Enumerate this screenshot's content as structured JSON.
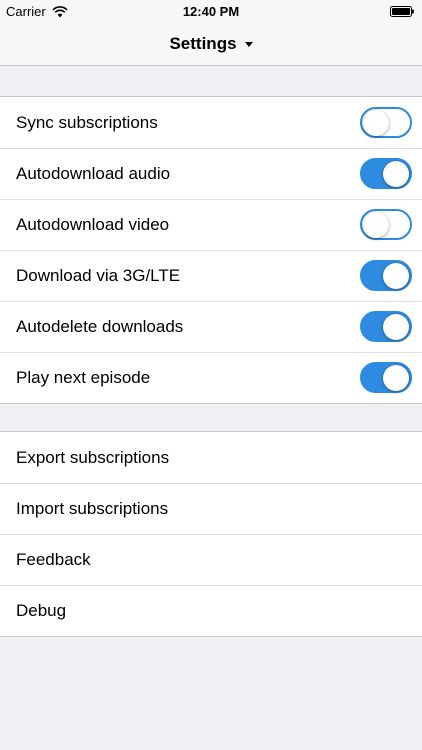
{
  "status_bar": {
    "carrier": "Carrier",
    "time": "12:40 PM",
    "wifi_icon": "wifi-icon",
    "battery_icon": "battery-icon"
  },
  "nav": {
    "title": "Settings",
    "dropdown_icon": "caret-down-icon"
  },
  "colors": {
    "accent": "#2d8be0",
    "background": "#efeff4",
    "bar": "#f7f7f7"
  },
  "toggles": [
    {
      "label": "Sync subscriptions",
      "on": false
    },
    {
      "label": "Autodownload audio",
      "on": true
    },
    {
      "label": "Autodownload video",
      "on": false
    },
    {
      "label": "Download via 3G/LTE",
      "on": true
    },
    {
      "label": "Autodelete downloads",
      "on": true
    },
    {
      "label": "Play next episode",
      "on": true
    }
  ],
  "actions": [
    {
      "label": "Export subscriptions"
    },
    {
      "label": "Import subscriptions"
    },
    {
      "label": "Feedback"
    },
    {
      "label": "Debug"
    }
  ]
}
